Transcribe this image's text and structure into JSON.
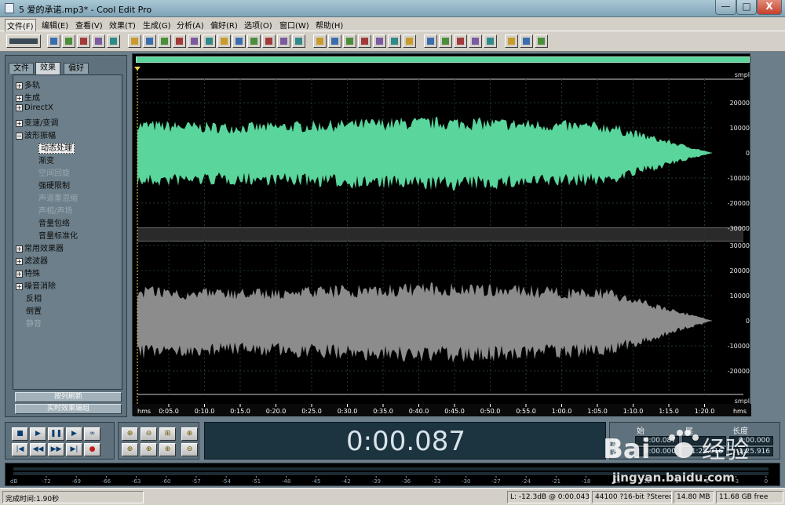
{
  "window": {
    "title": "5 爱的承诺.mp3* - Cool Edit Pro",
    "controls": {
      "minimize": "—",
      "maximize": "□",
      "close": "X"
    }
  },
  "menu": [
    "文件(F)",
    "编辑(E)",
    "查看(V)",
    "效果(T)",
    "生成(G)",
    "分析(A)",
    "偏好(R)",
    "选项(O)",
    "窗口(W)",
    "帮助(H)"
  ],
  "toolbar": {
    "icons": [
      "waveform-toggle-icon",
      "new-file-icon",
      "open-file-icon",
      "save-icon",
      "save-as-icon",
      "close-file-icon",
      "undo-icon",
      "redo-icon",
      "cut-icon",
      "copy-icon",
      "paste-icon",
      "mix-paste-icon",
      "trim-icon",
      "silence-icon",
      "amplify-icon",
      "envelope-icon",
      "stretch-icon",
      "noise-reduction-icon",
      "spectral-view-icon",
      "frequency-icon",
      "envelope-view-icon",
      "balance-icon",
      "multitrack-icon",
      "cue-list-icon",
      "play-list-icon",
      "snap-icon",
      "zoom-icon",
      "analysis-icon",
      "stats-icon",
      "levels-icon",
      "script-icon",
      "notepad-icon",
      "help-icon"
    ],
    "accent": "#0b3d6e"
  },
  "left_panel": {
    "tabs": [
      "文件",
      "效果",
      "偏好"
    ],
    "active_tab": "效果",
    "tree": [
      {
        "label": "多轨",
        "type": "group"
      },
      {
        "label": "生成",
        "type": "group"
      },
      {
        "label": "DirectX",
        "type": "group"
      },
      {
        "label": "变速/变调",
        "type": "group"
      },
      {
        "label": "波形振幅",
        "type": "group-open"
      },
      {
        "label": "动态处理",
        "type": "child-selected"
      },
      {
        "label": "渐变",
        "type": "child"
      },
      {
        "label": "空间回旋",
        "type": "child-disabled"
      },
      {
        "label": "强硬限制",
        "type": "child"
      },
      {
        "label": "声道重混缩",
        "type": "child-disabled"
      },
      {
        "label": "声相/声场",
        "type": "child-disabled"
      },
      {
        "label": "音量包络",
        "type": "child"
      },
      {
        "label": "音量标准化",
        "type": "child"
      },
      {
        "label": "常用效果器",
        "type": "group"
      },
      {
        "label": "滤波器",
        "type": "group"
      },
      {
        "label": "特殊",
        "type": "group"
      },
      {
        "label": "噪音消除",
        "type": "group"
      },
      {
        "label": "反相",
        "type": "leaf"
      },
      {
        "label": "倒置",
        "type": "leaf"
      },
      {
        "label": "静音",
        "type": "leaf-disabled"
      }
    ],
    "buttons": [
      "按列刷新",
      "实时效果编组"
    ]
  },
  "waveform": {
    "top_channel_color": "#5ad59c",
    "bottom_channel_color": "#8c8c8c",
    "unit_label": "smpl",
    "ruler_top": [
      "20000",
      "10000",
      "0",
      "-10000",
      "-20000",
      "-30000"
    ],
    "ruler_bottom": [
      "30000",
      "20000",
      "10000",
      "0",
      "-10000",
      "-20000"
    ],
    "time_unit": "hms",
    "time_labels": [
      "0:05.0",
      "0:10.0",
      "0:15.0",
      "0:20.0",
      "0:25.0",
      "0:30.0",
      "0:35.0",
      "0:40.0",
      "0:45.0",
      "0:50.0",
      "0:55.0",
      "1:00.0",
      "1:05.0",
      "1:10.0",
      "1:15.0",
      "1:20.0"
    ]
  },
  "transport": {
    "buttons": [
      {
        "name": "stop-button",
        "glyph": "■"
      },
      {
        "name": "play-button",
        "glyph": "▶"
      },
      {
        "name": "pause-button",
        "glyph": "❚❚"
      },
      {
        "name": "play-to-end-button",
        "glyph": "▶"
      },
      {
        "name": "loop-button",
        "glyph": "∞"
      },
      {
        "name": "go-start-button",
        "glyph": "|◀"
      },
      {
        "name": "rewind-button",
        "glyph": "◀◀"
      },
      {
        "name": "fast-forward-button",
        "glyph": "▶▶"
      },
      {
        "name": "go-end-button",
        "glyph": "▶|"
      },
      {
        "name": "record-button",
        "glyph": "●"
      }
    ],
    "zoom_buttons": [
      {
        "name": "zoom-in-horizontal-button",
        "glyph": "⊕"
      },
      {
        "name": "zoom-out-horizontal-button",
        "glyph": "⊖"
      },
      {
        "name": "zoom-full-button",
        "glyph": "⊞"
      },
      {
        "name": "zoom-in-vertical-button",
        "glyph": "⊕"
      },
      {
        "name": "zoom-selection-button",
        "glyph": "⊕"
      },
      {
        "name": "zoom-left-button",
        "glyph": "⊕"
      },
      {
        "name": "zoom-right-button",
        "glyph": "⊕"
      },
      {
        "name": "zoom-out-vertical-button",
        "glyph": "⊖"
      }
    ]
  },
  "time_display": "0:00.087",
  "selection": {
    "headers": {
      "start": "始",
      "end": "尾",
      "length": "长度"
    },
    "rows": [
      {
        "label": "选",
        "start": "0:00.087",
        "end": "",
        "length": "0:00.000"
      },
      {
        "label": "查",
        "start": "0:00.000",
        "end": "1:25.916",
        "length": "1:25.916"
      }
    ]
  },
  "meter": {
    "unit": "dB",
    "labels": [
      "-72",
      "-69",
      "-66",
      "-63",
      "-60",
      "-57",
      "-54",
      "-51",
      "-48",
      "-45",
      "-42",
      "-39",
      "-36",
      "-33",
      "-30",
      "-27",
      "-24",
      "-21",
      "-18",
      "-15",
      "-12",
      "-9",
      "-6",
      "-3",
      "0"
    ]
  },
  "status": {
    "message": "完成时间:1.90秒",
    "level": "L: -12.3dB @  0:00.043",
    "format": "44100 ?16-bit ?Stereo",
    "file_size": "14.80 MB",
    "free_space": "11.68 GB free"
  },
  "watermark": {
    "brand": "Bai du 经验",
    "site": "jingyan.baidu.com"
  }
}
